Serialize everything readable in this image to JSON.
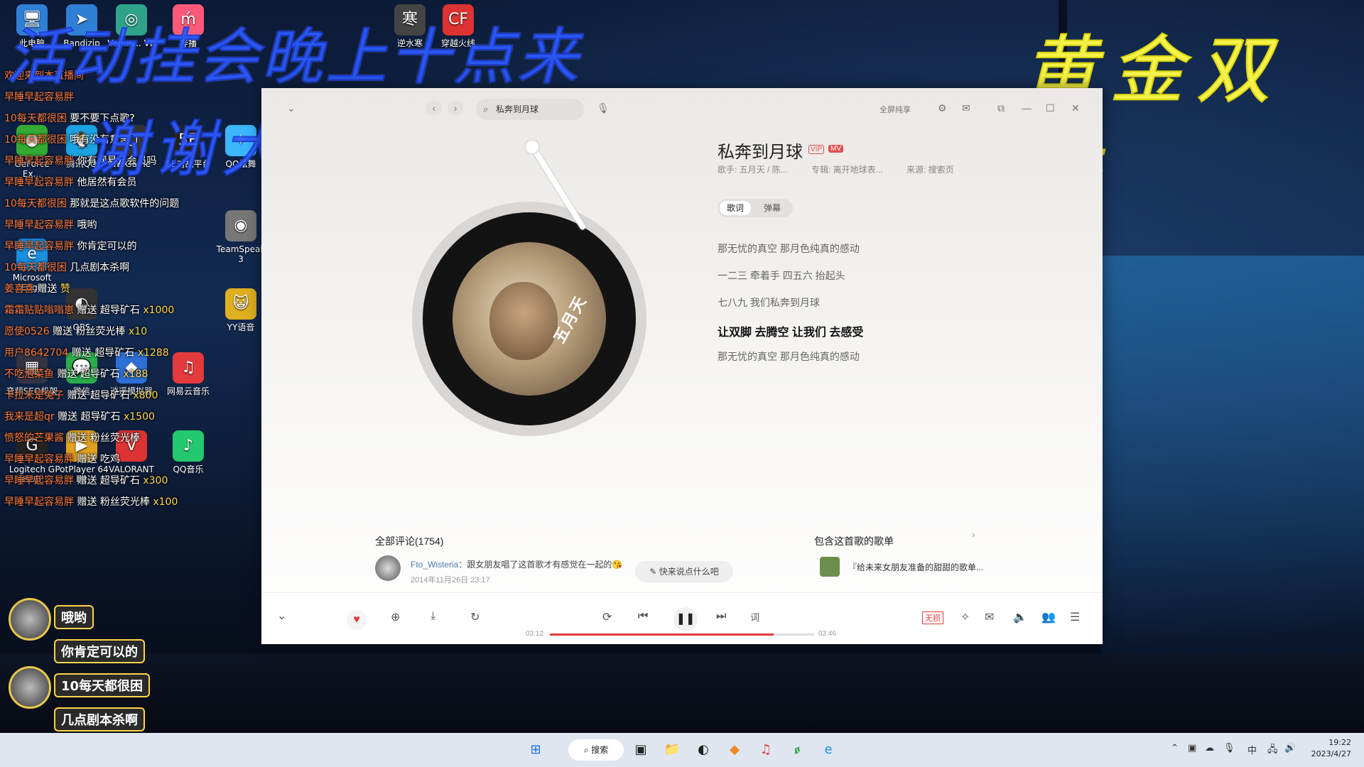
{
  "overlays": {
    "top_left": "活动挂会晚上十点来",
    "second": "谢谢大家",
    "top_right": "黄金双倍"
  },
  "desktop_icons": [
    {
      "label": "此电脑",
      "glyph": "🖥"
    },
    {
      "label": "Bandizip",
      "glyph": "➤"
    },
    {
      "label": "Venus... VK",
      "glyph": "◎"
    },
    {
      "label": "哔播",
      "glyph": "ḿ"
    },
    {
      "label": "GeForce Ex...",
      "glyph": "●"
    },
    {
      "label": "腾讯QQ",
      "glyph": "🐧"
    },
    {
      "label": "WeGame",
      "glyph": "⬡"
    },
    {
      "label": "5E对战平台",
      "glyph": "5E"
    },
    {
      "label": "QQ炫舞",
      "glyph": "✦"
    },
    {
      "label": "Microsoft Edge",
      "glyph": "e"
    },
    {
      "label": "TeamSpeak 3",
      "glyph": "◉"
    },
    {
      "label": "OBS",
      "glyph": "◐"
    },
    {
      "label": "YY语音",
      "glyph": "😺"
    },
    {
      "label": "音频SEQ机架",
      "glyph": "▦"
    },
    {
      "label": "微信",
      "glyph": "💬"
    },
    {
      "label": "逍遥模拟器",
      "glyph": "◆"
    },
    {
      "label": "网易云音乐",
      "glyph": "♫"
    },
    {
      "label": "Logitech G HUB",
      "glyph": "G"
    },
    {
      "label": "PotPlayer 64 bit",
      "glyph": "▶"
    },
    {
      "label": "VALORANT",
      "glyph": "V"
    },
    {
      "label": "QQ音乐",
      "glyph": "♪"
    },
    {
      "label": "逆水寒",
      "glyph": "寒"
    },
    {
      "label": "穿越火线",
      "glyph": "CF"
    }
  ],
  "chat": [
    {
      "user": "欢迎来到本直播间",
      "text": "",
      "gift": ""
    },
    {
      "user": "早睡早起容易胖",
      "text": "",
      "gift": ""
    },
    {
      "user": "10每天都很困",
      "text": "要不要下点歌?",
      "gift": ""
    },
    {
      "user": "10每天都很困",
      "text": "哦有没有意思",
      "gift": ""
    },
    {
      "user": "早睡早起容易胖",
      "text": "你有网易云会员吗",
      "gift": ""
    },
    {
      "user": "早睡早起容易胖",
      "text": "他居然有会员",
      "gift": ""
    },
    {
      "user": "10每天都很困",
      "text": "那就是这点歌软件的问题",
      "gift": ""
    },
    {
      "user": "早睡早起容易胖",
      "text": "哦哟",
      "gift": ""
    },
    {
      "user": "早睡早起容易胖",
      "text": "你肯定可以的",
      "gift": ""
    },
    {
      "user": "10每天都很困",
      "text": "几点剧本杀啊",
      "gift": ""
    },
    {
      "user": "姜喜喜",
      "text": "赠送",
      "gift": "赞"
    },
    {
      "user": "霜霜贴贴嗡嗡崽",
      "text": "赠送 超导矿石",
      "gift": "x1000"
    },
    {
      "user": "愿使0526",
      "text": "赠送 粉丝荧光棒",
      "gift": "x10"
    },
    {
      "user": "用户8642704",
      "text": "赠送 超导矿石",
      "gift": "x1288"
    },
    {
      "user": "不吃泡菜鱼",
      "text": "赠送 超导矿石",
      "gift": "x188"
    },
    {
      "user": "卡拉米是兔子",
      "text": "赠送 超导矿石",
      "gift": "x800"
    },
    {
      "user": "我来是超qr",
      "text": "赠送 超导矿石",
      "gift": "x1500"
    },
    {
      "user": "愤怒的芒果酱",
      "text": "赠送 粉丝荧光棒",
      "gift": ""
    },
    {
      "user": "早睡早起容易胖",
      "text": "赠送 吃鸡",
      "gift": ""
    },
    {
      "user": "早睡早起容易胖",
      "text": "赠送 超导矿石",
      "gift": "x300"
    },
    {
      "user": "早睡早起容易胖",
      "text": "赠送 粉丝荧光棒",
      "gift": "x100"
    }
  ],
  "bubbles": [
    "哦哟",
    "你肯定可以的",
    "10每天都很困",
    "几点剧本杀啊"
  ],
  "app": {
    "search_value": "私奔到月球",
    "fullscreen_label": "全屏纯享",
    "song_title": "私奔到月球",
    "vip": "VIP",
    "mv": "MV",
    "singer": "歌手: 五月天 / 陈...",
    "album": "专辑: 离开地球表...",
    "source": "来源: 搜索页",
    "tabs": [
      "歌词",
      "弹幕"
    ],
    "lyrics": [
      "那无忧的真空 那月色纯真的感动",
      "一二三 牵着手 四五六 抬起头",
      "七八九 我们私奔到月球",
      "让双脚 去腾空 让我们 去感受",
      "那无忧的真空 那月色纯真的感动"
    ],
    "active_lyric_index": 3,
    "comments_heading": "全部评论(1754)",
    "comment_user": "Fto_Wisteria",
    "comment_text": "跟女朋友唱了这首歌才有感觉在一起的😘",
    "comment_time": "2014年11月26日 23:17",
    "comment_input_placeholder": "快来说点什么吧",
    "playlist_heading": "包含这首歌的歌单",
    "playlist_item": "『给未来女朋友准备的甜甜的歌单...",
    "cover_text": "五月天",
    "time_current": "03:12",
    "time_total": "03:46",
    "progress": 0.848,
    "lyric_btn": "词",
    "lossless": "无损"
  },
  "taskbar": {
    "search_label": "搜索",
    "ime": "中",
    "time": "19:22",
    "date": "2023/4/27"
  },
  "colors": {
    "accent": "#e33b3b",
    "overlay_blue": "#2c5cff",
    "overlay_yellow": "#f4f24a"
  }
}
